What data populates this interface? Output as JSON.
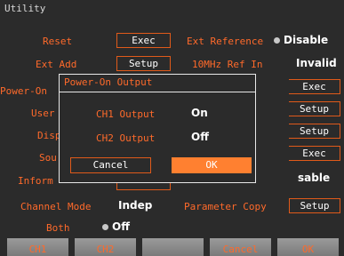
{
  "title": "Utility",
  "left": {
    "reset_label": "Reset",
    "reset_btn": "Exec",
    "extadd_label": "Ext Add",
    "extadd_btn": "Setup",
    "poweron_label": "Power-On",
    "user_label": "User",
    "disp_label": "Disp",
    "sou_label": "Sou",
    "info_label": "Inform"
  },
  "right": {
    "extref_label": "Ext Reference",
    "extref_value": "Disable",
    "ref10_label": "10MHz Ref In",
    "ref10_value": "Invalid",
    "btn1": "Exec",
    "btn2": "Setup",
    "btn3": "Setup",
    "btn4": "Exec",
    "value5": "sable"
  },
  "channel_mode": {
    "label": "Channel Mode",
    "value": "Indep"
  },
  "param_copy": {
    "label": "Parameter Copy",
    "button": "Setup"
  },
  "both": {
    "label": "Both",
    "value": "Off"
  },
  "dialog": {
    "title": "Power-On Output",
    "ch1_label": "CH1 Output",
    "ch1_value": "On",
    "ch2_label": "CH2 Output",
    "ch2_value": "Off",
    "cancel": "Cancel",
    "ok": "OK"
  },
  "softkeys": [
    "CH1",
    "CH2",
    "",
    "Cancel",
    "OK"
  ]
}
